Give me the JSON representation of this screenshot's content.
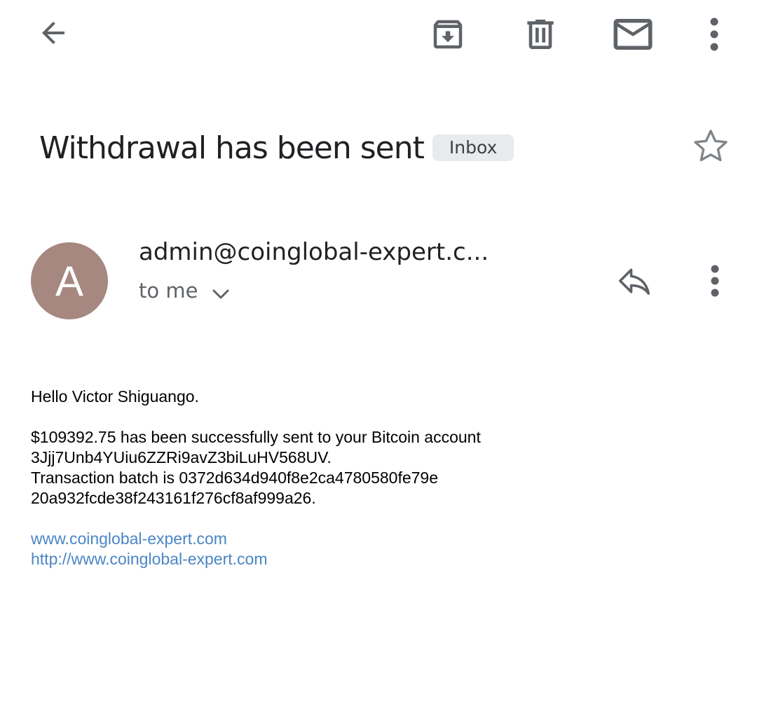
{
  "toolbar": {
    "icons": [
      "back-arrow-icon",
      "archive-icon",
      "trash-icon",
      "mail-icon",
      "more-vert-icon"
    ]
  },
  "email": {
    "subject": "Withdrawal has been sent",
    "label": "Inbox",
    "starred": false
  },
  "sender": {
    "avatar_letter": "A",
    "avatar_color": "#a68881",
    "address": "admin@coinglobal-expert.c...",
    "recipient": "to me"
  },
  "body": {
    "greeting": "Hello Victor Shiguango.",
    "line1": "$109392.75 has been successfully sent to your Bitcoin account",
    "line2": "3Jjj7Unb4YUiu6ZZRi9avZ3biLuHV568UV.",
    "line3": "Transaction batch is 0372d634d940f8e2ca4780580fe79e",
    "line4": "20a932fcde38f243161f276cf8af999a26.",
    "link1": "www.coinglobal-expert.com",
    "link2": "http://www.coinglobal-expert.com"
  },
  "colors": {
    "icon": "#5f6368",
    "link": "#4a86c5",
    "chip_bg": "#e8eaed"
  }
}
